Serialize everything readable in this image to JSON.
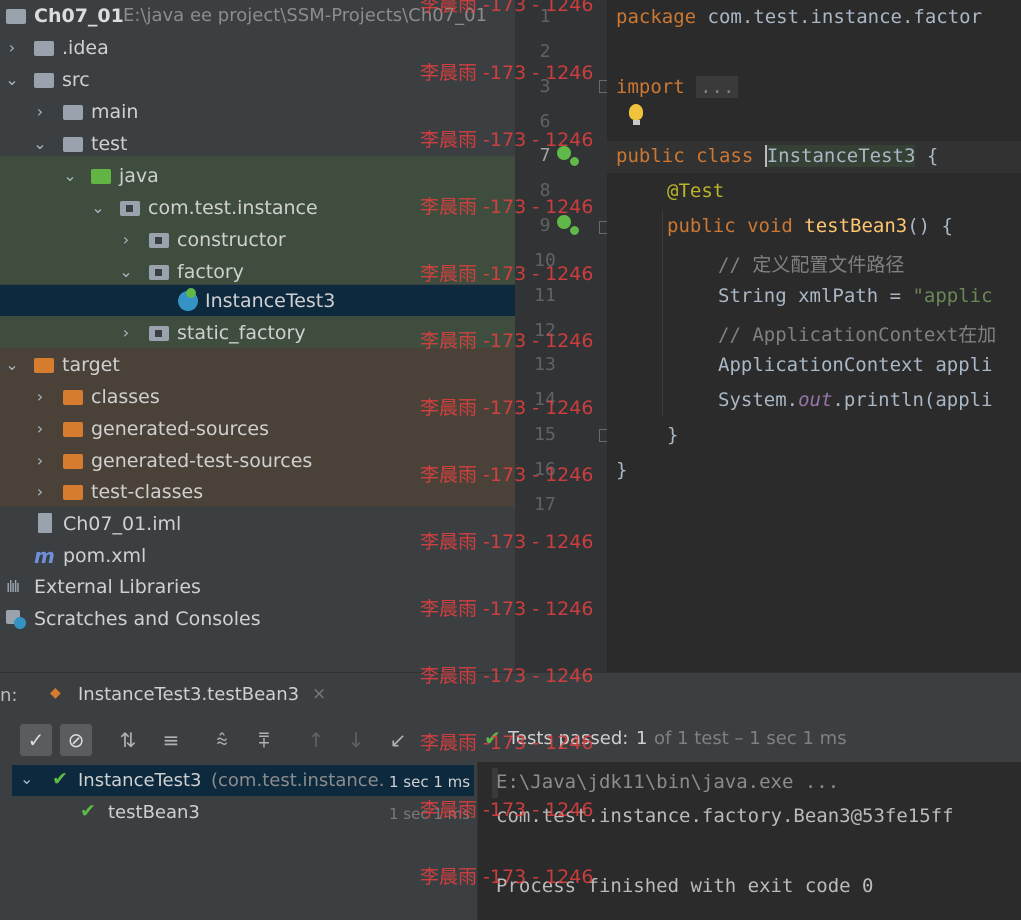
{
  "project": {
    "root_name": "Ch07_01",
    "root_path": "E:\\java ee project\\SSM-Projects\\Ch07_01",
    "items": [
      {
        "label": ".idea"
      },
      {
        "label": "src"
      },
      {
        "label": "main"
      },
      {
        "label": "test"
      },
      {
        "label": "java"
      },
      {
        "label": "com.test.instance"
      },
      {
        "label": "constructor"
      },
      {
        "label": "factory"
      },
      {
        "label": "InstanceTest3"
      },
      {
        "label": "static_factory"
      },
      {
        "label": "target"
      },
      {
        "label": "classes"
      },
      {
        "label": "generated-sources"
      },
      {
        "label": "generated-test-sources"
      },
      {
        "label": "test-classes"
      },
      {
        "label": "Ch07_01.iml"
      },
      {
        "label": "pom.xml"
      },
      {
        "label": "External Libraries"
      },
      {
        "label": "Scratches and Consoles"
      }
    ]
  },
  "editor": {
    "line_numbers": [
      "1",
      "2",
      "3",
      "6",
      "7",
      "8",
      "9",
      "10",
      "11",
      "12",
      "13",
      "14",
      "15",
      "16",
      "17"
    ],
    "code": {
      "l1_kw": "package",
      "l1_rest": " com.test.instance.factor",
      "l3_kw": "import",
      "l3_fold": "...",
      "l7_kw": "public class ",
      "l7_name": "InstanceTest3",
      "l7_rest": " {",
      "l8_ann": "@Test",
      "l9_kw": "public void ",
      "l9_fn": "testBean3",
      "l9_rest": "() {",
      "l10_cm": "// 定义配置文件路径",
      "l11_a": "String xmlPath = ",
      "l11_str": "\"applic",
      "l12_cm": "// ApplicationContext在加",
      "l13": "ApplicationContext appli",
      "l14_a": "System.",
      "l14_fld": "out",
      "l14_b": ".println(appli",
      "l15": "}",
      "l16": "}"
    }
  },
  "watermark": "李晨雨 -173 - 1246",
  "run": {
    "label": "n:",
    "tab_title": "InstanceTest3.testBean3",
    "status_prefix": "Tests passed:",
    "status_count": "1",
    "status_rest": "of 1 test – 1 sec 1 ms",
    "tree": [
      {
        "name": "InstanceTest3",
        "detail": "(com.test.instance.",
        "time": "1 sec 1 ms"
      },
      {
        "name": "testBean3",
        "detail": "",
        "time": "1 sec 1 ms"
      }
    ],
    "console": [
      "E:\\Java\\jdk11\\bin\\java.exe ...",
      "com.test.instance.factory.Bean3@53fe15ff",
      "",
      "Process finished with exit code 0"
    ]
  }
}
